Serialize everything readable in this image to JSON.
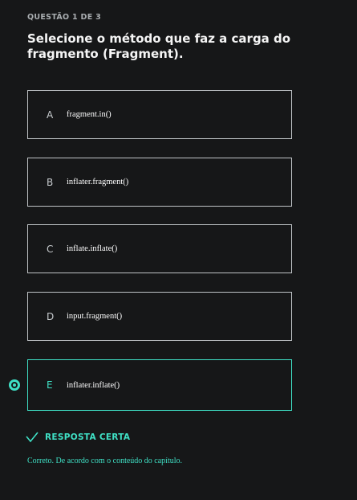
{
  "question": {
    "counter": "QUESTÃO 1 DE 3",
    "title": "Selecione o método que faz a carga do fragmento (Fragment)."
  },
  "options": [
    {
      "letter": "A",
      "text": "fragment.in()",
      "selected": false
    },
    {
      "letter": "B",
      "text": "inflater.fragment()",
      "selected": false
    },
    {
      "letter": "C",
      "text": "inflate.inflate()",
      "selected": false
    },
    {
      "letter": "D",
      "text": "input.fragment()",
      "selected": false
    },
    {
      "letter": "E",
      "text": "inflater.inflate()",
      "selected": true
    }
  ],
  "result": {
    "icon": "check-icon",
    "label": "RESPOSTA CERTA",
    "feedback": "Correto. De acordo com o conteúdo do capítulo."
  },
  "colors": {
    "background": "#161718",
    "accent": "#3fe0c5",
    "border": "#bfc3c6"
  }
}
